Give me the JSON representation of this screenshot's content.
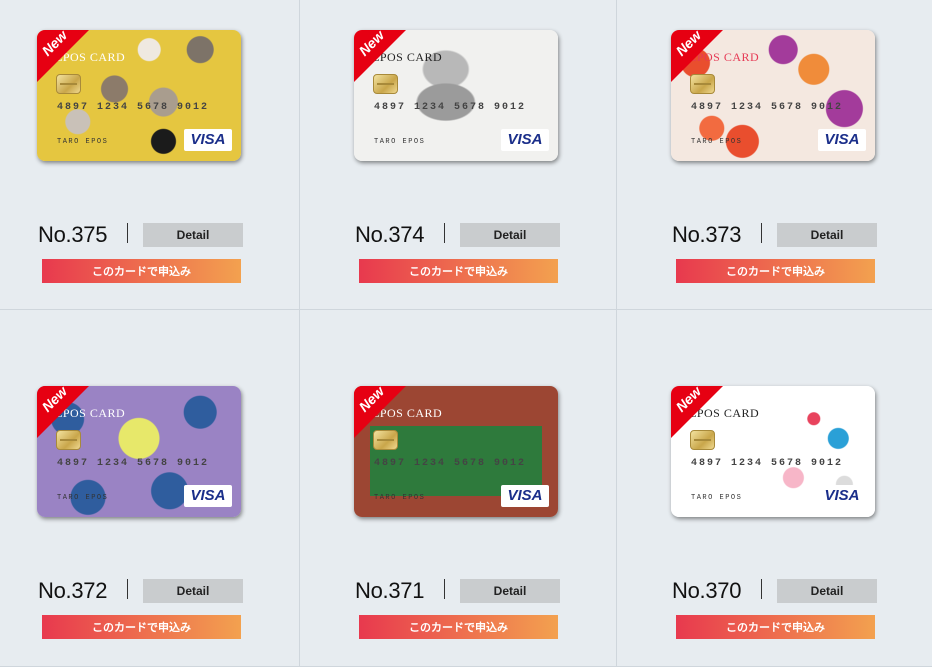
{
  "ribbon_label": "New",
  "card_brand": "EPOS CARD",
  "card_number": "4897 1234 5678 9012",
  "card_holder": "TARO EPOS",
  "visa_label": "VISA",
  "detail_label": "Detail",
  "apply_label": "このカードで申込み",
  "cards": [
    {
      "number": "No.375",
      "design": "cats-collage",
      "colors": [
        "#e5c640",
        "#5b4a3a"
      ]
    },
    {
      "number": "No.374",
      "design": "grey-cat",
      "colors": [
        "#f1f1ef",
        "#8d8d8d"
      ]
    },
    {
      "number": "No.373",
      "design": "paper-umbrellas",
      "colors": [
        "#f4e8e0",
        "#e94e2e",
        "#a33b9b"
      ]
    },
    {
      "number": "No.372",
      "design": "hydrangea",
      "colors": [
        "#9a83c4",
        "#2f5d9e",
        "#e7e86a"
      ]
    },
    {
      "number": "No.371",
      "design": "tennis-court",
      "colors": [
        "#9c4633",
        "#2e7a3c"
      ]
    },
    {
      "number": "No.370",
      "design": "doodle-stickers",
      "colors": [
        "#ffffff",
        "#e8435d",
        "#2aa0d7"
      ]
    }
  ]
}
